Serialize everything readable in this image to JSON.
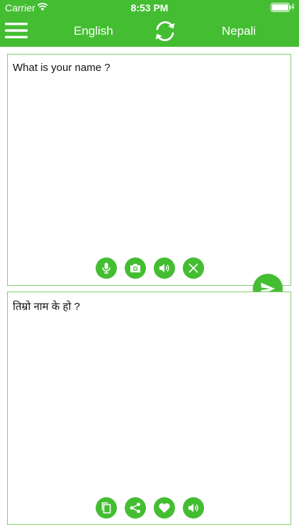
{
  "status_bar": {
    "carrier": "Carrier",
    "time": "8:53 PM"
  },
  "nav": {
    "source_language": "English",
    "target_language": "Nepali",
    "menu_icon": "hamburger-menu-icon",
    "swap_icon": "refresh-swap-icon"
  },
  "source": {
    "text": "What is your name ?",
    "actions": [
      "microphone-icon",
      "camera-icon",
      "speaker-icon",
      "clear-icon"
    ]
  },
  "target": {
    "text": "तिम्रो नाम के हो ?",
    "actions": [
      "copy-icon",
      "share-icon",
      "heart-icon",
      "speaker-icon"
    ]
  },
  "send_icon": "send-icon",
  "colors": {
    "accent": "#44bd32",
    "border": "#7fce6e",
    "text": "#111111"
  }
}
